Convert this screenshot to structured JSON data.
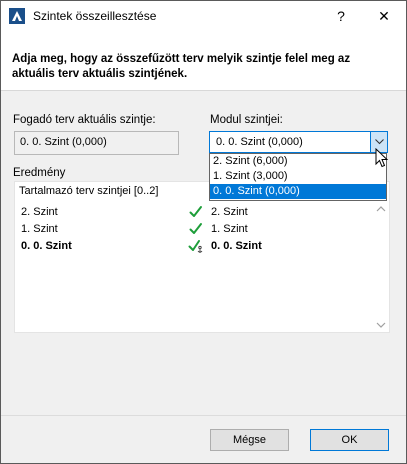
{
  "window": {
    "title": "Szintek összeillesztése",
    "help_glyph": "?",
    "close_glyph": "✕"
  },
  "instruction": "Adja meg, hogy az összefűzött terv melyik szintje felel meg az aktuális terv aktuális szintjének.",
  "host": {
    "label": "Fogadó terv aktuális szintje:",
    "value": "0. 0. Szint (0,000)"
  },
  "module": {
    "label": "Modul szintjei:",
    "selected": "0. 0. Szint (0,000)",
    "options": [
      "2. Szint (6,000)",
      "1. Szint (3,000)",
      "0. 0. Szint (0,000)"
    ],
    "selected_index": 2
  },
  "result": {
    "label": "Eredmény",
    "column_header": "Tartalmazó terv szintjei [0..2]",
    "rows": [
      {
        "left": "2. Szint",
        "right": "2. Szint",
        "bold": false
      },
      {
        "left": "1. Szint",
        "right": "1. Szint",
        "bold": false
      },
      {
        "left": "0. 0. Szint",
        "right": "0. 0. Szint",
        "bold": true
      }
    ]
  },
  "buttons": {
    "cancel": "Mégse",
    "ok": "OK"
  },
  "colors": {
    "accent": "#0078d7",
    "check": "#1e9e3a"
  },
  "icons": {
    "app": "archicad-icon",
    "check": "check-icon",
    "check_anchor": "check-anchor-icon",
    "close": "close-icon",
    "help": "help-icon",
    "dropdown": "chevron-down-icon"
  }
}
